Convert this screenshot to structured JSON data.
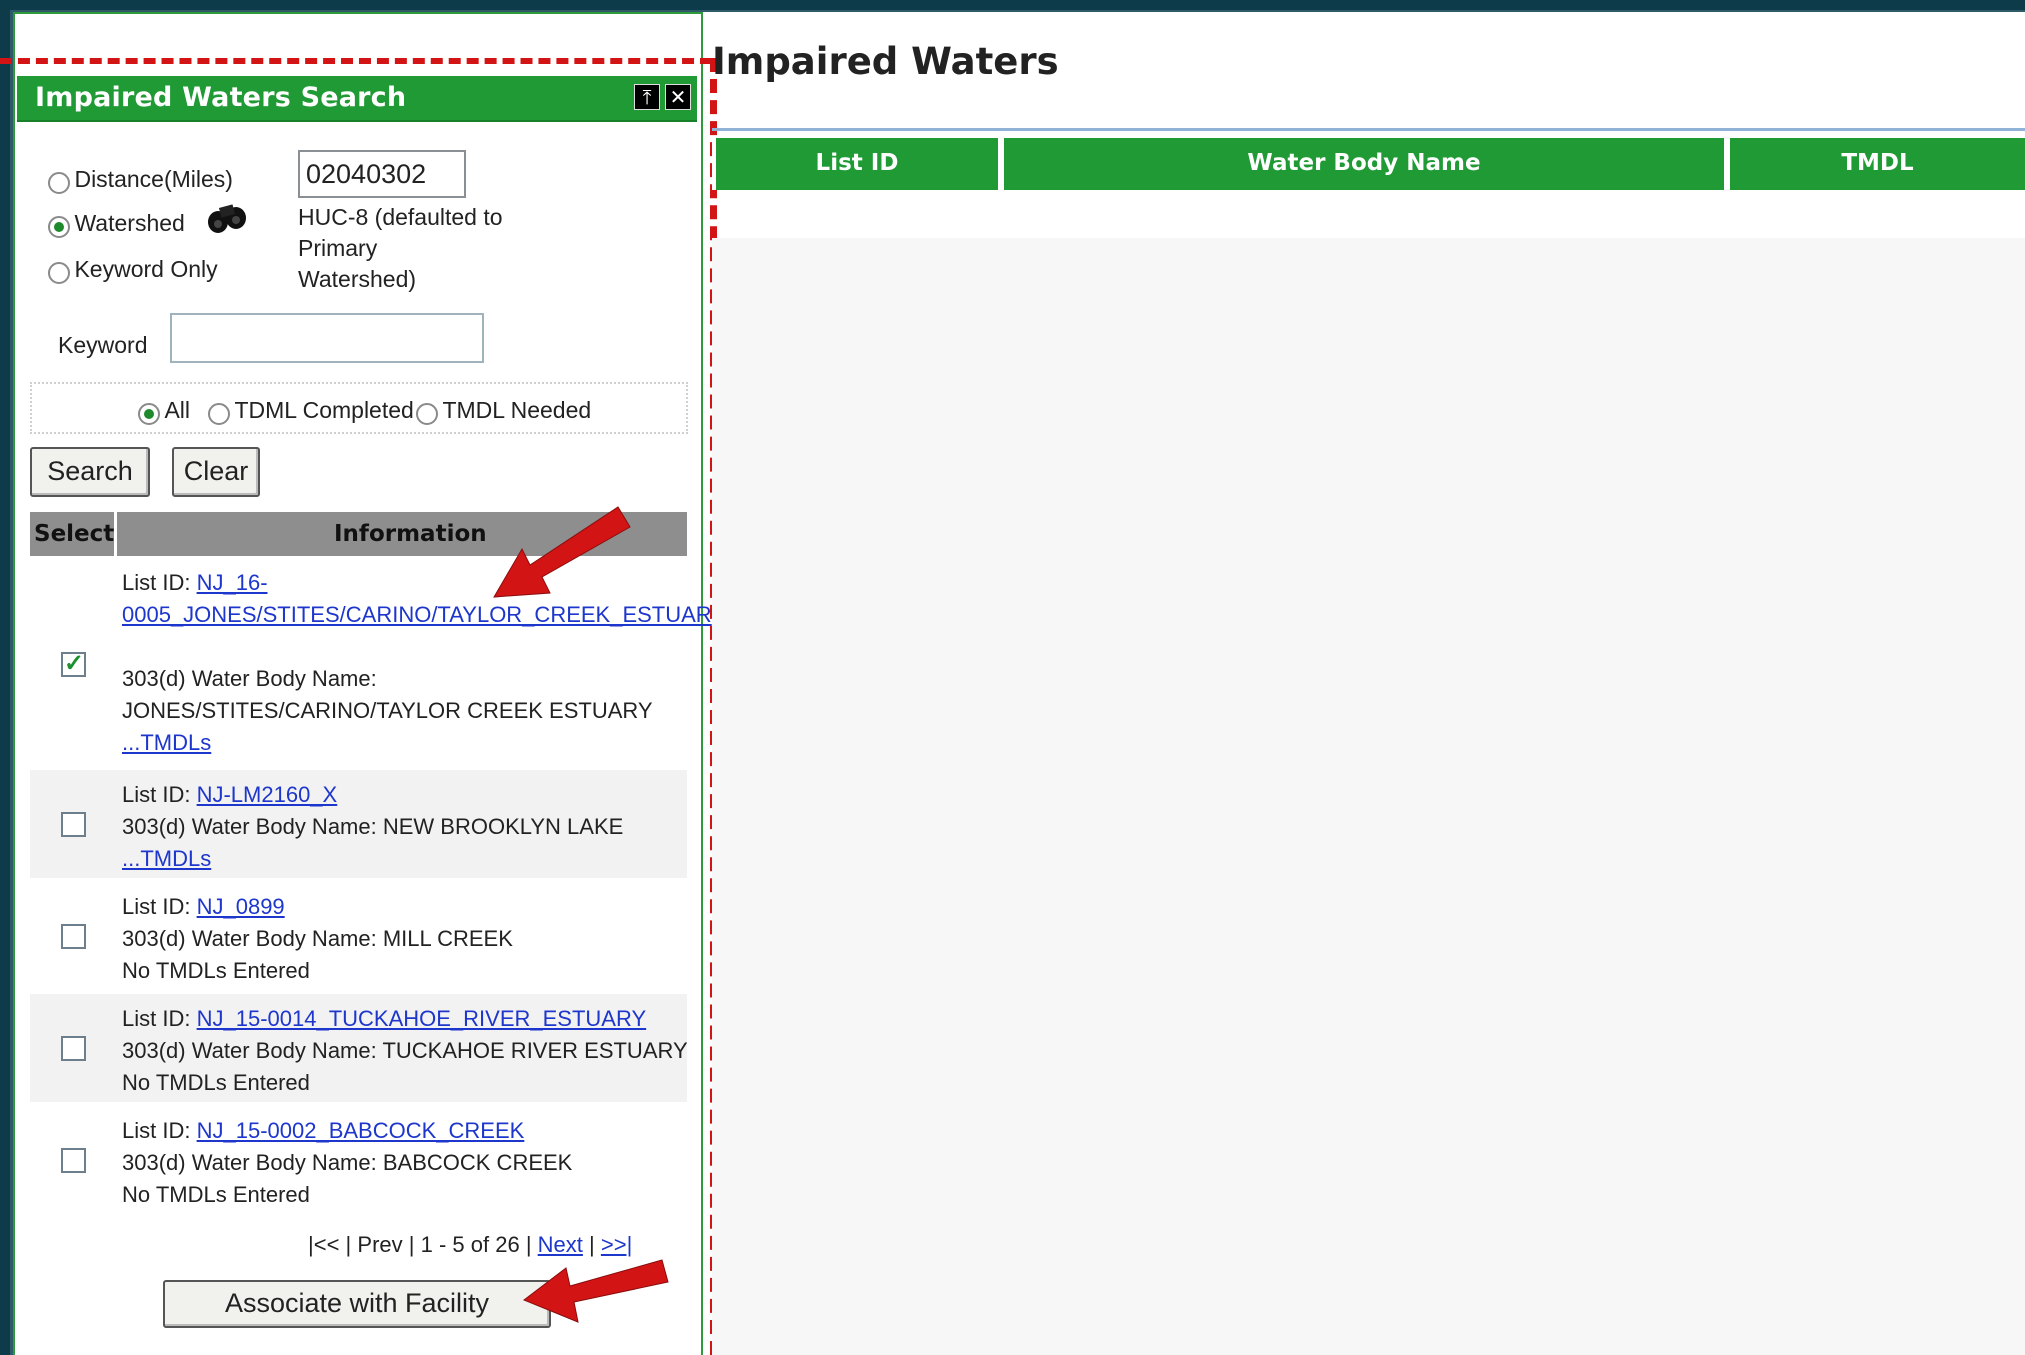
{
  "panel": {
    "title": "Impaired Waters Search",
    "pin_icon": "⤒",
    "close_icon": "✕"
  },
  "search": {
    "radio_distance": "Distance(Miles)",
    "radio_watershed": "Watershed",
    "radio_keyword": "Keyword Only",
    "selected_mode": "Watershed",
    "huc_value": "02040302",
    "huc_note_1": "HUC-8 (defaulted to",
    "huc_note_2": "Primary",
    "huc_note_3": "Watershed)",
    "keyword_label": "Keyword",
    "keyword_value": "",
    "filter_all": "All",
    "filter_completed": "TDML Completed",
    "filter_needed": "TMDL Needed",
    "selected_filter": "All",
    "search_button": "Search",
    "clear_button": "Clear"
  },
  "results": {
    "col_select": "Select",
    "col_information": "Information",
    "rows": [
      {
        "checked": true,
        "list_id_label": "List ID:",
        "list_id_1": "NJ_16-",
        "list_id_2": "0005_JONES/STITES/CARINO/TAYLOR_CREEK_ESTUAR",
        "wb_label": "303(d) Water Body Name:",
        "wb_name": "JONES/STITES/CARINO/TAYLOR CREEK ESTUARY",
        "tmdl": "...TMDLs"
      },
      {
        "checked": false,
        "list_id_label": "List ID:",
        "list_id": "NJ-LM2160_X",
        "wb_label": "303(d) Water Body Name:",
        "wb_name": "NEW BROOKLYN LAKE",
        "tmdl": "...TMDLs"
      },
      {
        "checked": false,
        "list_id_label": "List ID:",
        "list_id": "NJ_0899",
        "wb_label": "303(d) Water Body Name:",
        "wb_name": "MILL CREEK",
        "tmdl": "No TMDLs Entered"
      },
      {
        "checked": false,
        "list_id_label": "List ID:",
        "list_id": "NJ_15-0014_TUCKAHOE_RIVER_ESTUARY",
        "wb_label": "303(d) Water Body Name:",
        "wb_name": "TUCKAHOE RIVER ESTUARY",
        "tmdl": "No TMDLs Entered"
      },
      {
        "checked": false,
        "list_id_label": "List ID:",
        "list_id": "NJ_15-0002_BABCOCK_CREEK",
        "wb_label": "303(d) Water Body Name:",
        "wb_name": "BABCOCK CREEK",
        "tmdl": "No TMDLs Entered"
      }
    ],
    "pager": {
      "first": "|<<",
      "prev": "Prev",
      "range": "1 - 5 of 26",
      "next": "Next",
      "last": ">>|",
      "sep": "|"
    },
    "associate_button": "Associate with Facility"
  },
  "main": {
    "title": "Impaired Waters",
    "columns": [
      "List ID",
      "Water Body Name",
      "TMDL"
    ]
  },
  "colors": {
    "panel_green": "#1f9a34",
    "annotation_red": "#d21414",
    "link_blue": "#1d36cc"
  }
}
